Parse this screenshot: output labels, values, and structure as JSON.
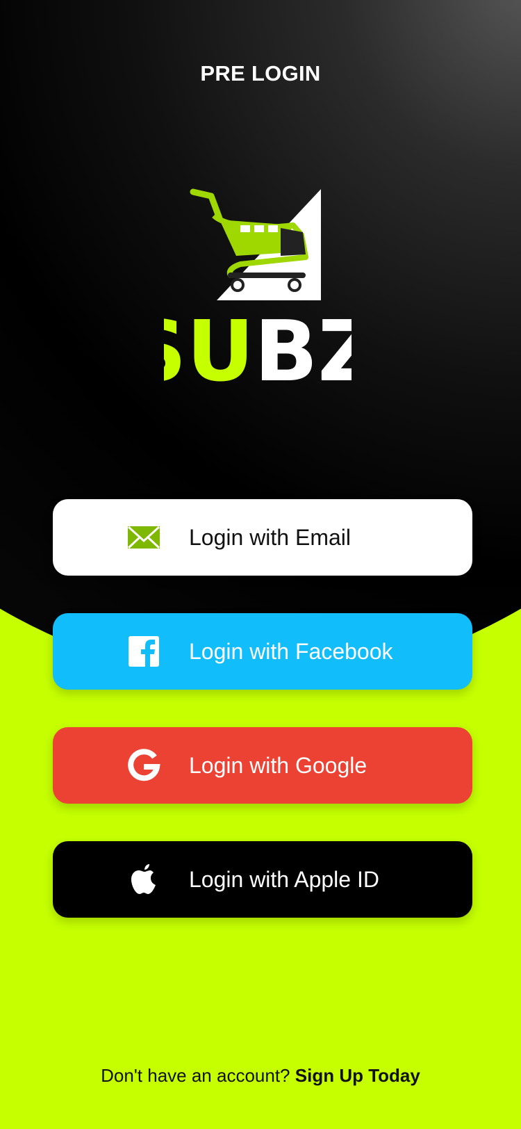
{
  "header": {
    "title": "PRE LOGIN"
  },
  "logo": {
    "text_green": "SU",
    "text_white": "BZ",
    "icon": "shopping-cart-icon"
  },
  "buttons": {
    "email": {
      "label": "Login with Email",
      "icon": "envelope-icon",
      "bg": "#ffffff"
    },
    "facebook": {
      "label": "Login with Facebook",
      "icon": "facebook-icon",
      "bg": "#12bdfc"
    },
    "google": {
      "label": "Login with Google",
      "icon": "google-icon",
      "bg": "#ec4234"
    },
    "apple": {
      "label": "Login with Apple ID",
      "icon": "apple-icon",
      "bg": "#000000"
    }
  },
  "footer": {
    "prompt": "Don't have an account?",
    "link": "Sign Up Today"
  },
  "colors": {
    "accent": "#c5ff00",
    "dark": "#000000"
  }
}
